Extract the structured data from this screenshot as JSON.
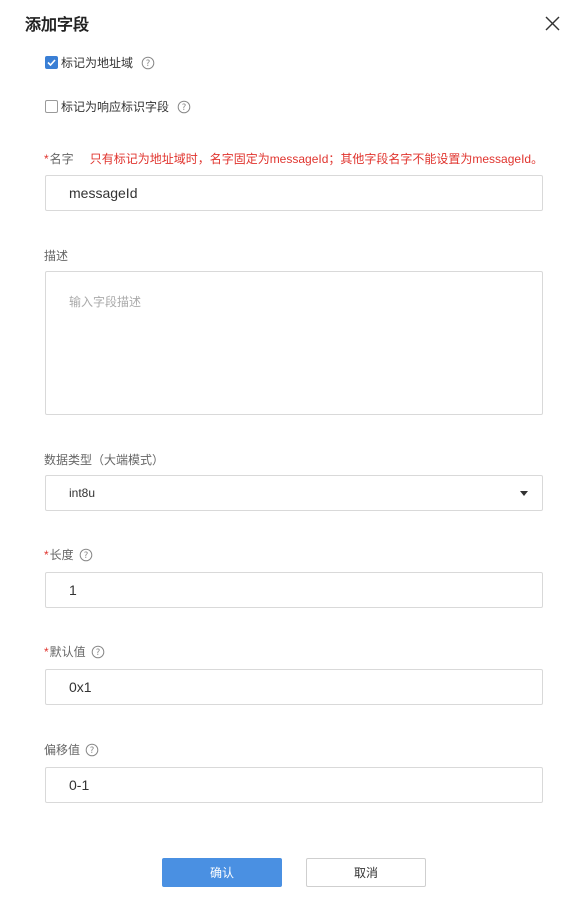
{
  "dialog": {
    "title": "添加字段",
    "close_icon": "close-icon"
  },
  "options": {
    "address_field": {
      "label": "标记为地址域",
      "checked": true
    },
    "response_id_field": {
      "label": "标记为响应标识字段",
      "checked": false
    }
  },
  "fields": {
    "name": {
      "required_mark": "*",
      "label": "名字",
      "hint": "只有标记为地址域时，名字固定为messageId；其他字段名字不能设置为messageId。",
      "value": "messageId"
    },
    "description": {
      "label": "描述",
      "placeholder": "输入字段描述",
      "value": ""
    },
    "data_type": {
      "label": "数据类型（大端模式）",
      "selected": "int8u"
    },
    "length": {
      "required_mark": "*",
      "label": "长度",
      "value": "1"
    },
    "default_value": {
      "required_mark": "*",
      "label": "默认值",
      "value": "0x1"
    },
    "offset": {
      "label": "偏移值",
      "value": "0-1"
    }
  },
  "buttons": {
    "confirm": "确认",
    "cancel": "取消"
  },
  "colors": {
    "primary": "#4a90e2",
    "required": "#e0342e",
    "checkbox_checked": "#3a7fd5"
  }
}
